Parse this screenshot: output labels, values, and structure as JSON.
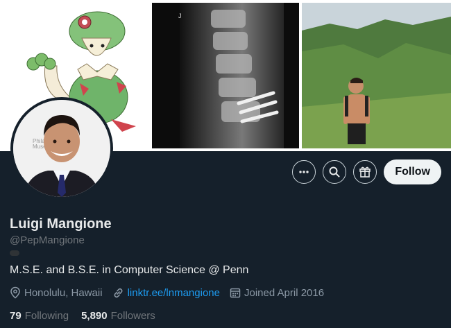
{
  "header_images": {
    "left": "pokemon-illustration",
    "middle": "spine-xray",
    "right": "mountain-hike-photo"
  },
  "avatar": {
    "background_text": "Philad\nMuse"
  },
  "actions": {
    "more_icon": "more-horizontal-icon",
    "search_icon": "search-icon",
    "gift_icon": "gift-icon",
    "follow_label": "Follow"
  },
  "profile": {
    "name": "Luigi Mangione",
    "handle": "@PepMangione",
    "bio": "M.S.E. and B.S.E. in Computer Science @ Penn",
    "location": "Honolulu, Hawaii",
    "link": "linktr.ee/lnmangione",
    "joined": "Joined April 2016"
  },
  "stats": {
    "following_count": "79",
    "following_label": "Following",
    "followers_count": "5,890",
    "followers_label": "Followers"
  },
  "colors": {
    "background": "#15202b",
    "accent": "#1d9bf0",
    "muted": "#71767b"
  }
}
